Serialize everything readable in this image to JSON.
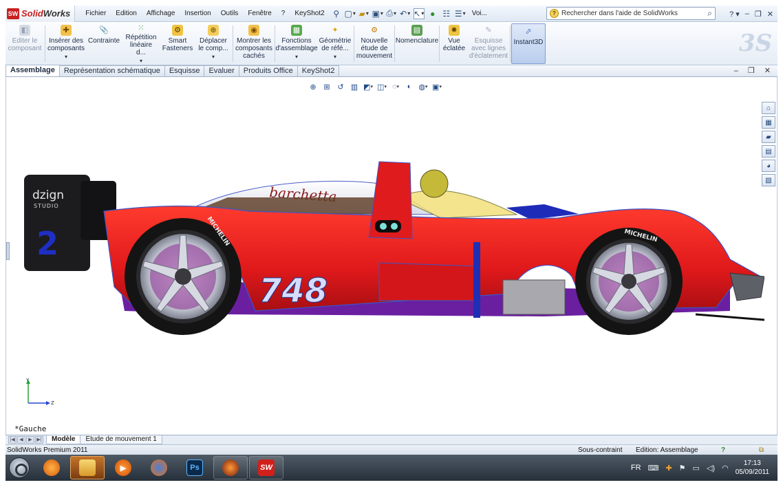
{
  "app": {
    "name_part1": "Solid",
    "name_part2": "Works",
    "badge": "SW"
  },
  "menu": [
    "Fichier",
    "Edition",
    "Affichage",
    "Insertion",
    "Outils",
    "Fenêtre",
    "?",
    "KeyShot2"
  ],
  "toolbar_trailing": "Voi...",
  "help_search": {
    "placeholder": "Rechercher dans l'aide de SolidWorks"
  },
  "ribbon": [
    {
      "id": "edit-component",
      "label": "Editer le composant",
      "icon": "edit-component-icon",
      "disabled": true
    },
    {
      "id": "insert-components",
      "label": "Insérer des composants",
      "icon": "insert-components-icon",
      "dropdown": true
    },
    {
      "id": "mate",
      "label": "Contrainte",
      "icon": "mate-paperclip-icon"
    },
    {
      "id": "linear-pattern",
      "label": "Répétition linéaire d...",
      "icon": "linear-pattern-icon",
      "dropdown": true
    },
    {
      "id": "smart-fasteners",
      "label": "Smart Fasteners",
      "icon": "smart-fasteners-icon"
    },
    {
      "id": "move-component",
      "label": "Déplacer le comp...",
      "icon": "move-component-icon",
      "dropdown": true
    },
    {
      "id": "show-hidden",
      "label": "Montrer les composants cachés",
      "icon": "show-hidden-icon"
    },
    {
      "id": "assembly-features",
      "label": "Fonctions d'assemblage",
      "icon": "assembly-features-icon",
      "dropdown": true
    },
    {
      "id": "reference-geometry",
      "label": "Géométrie de réfé...",
      "icon": "reference-geometry-icon",
      "dropdown": true
    },
    {
      "id": "new-motion-study",
      "label": "Nouvelle étude de mouvement",
      "icon": "motion-study-icon"
    },
    {
      "id": "bom",
      "label": "Nomenclature",
      "icon": "bill-of-materials-icon"
    },
    {
      "id": "exploded-view",
      "label": "Vue éclatée",
      "icon": "exploded-view-icon"
    },
    {
      "id": "explode-line-sketch",
      "label": "Esquisse avec lignes d'éclatement",
      "icon": "explode-line-sketch-icon",
      "disabled": true
    },
    {
      "id": "instant3d",
      "label": "Instant3D",
      "icon": "instant3d-icon",
      "active": true
    }
  ],
  "tabs": [
    "Assemblage",
    "Représentation schématique",
    "Esquisse",
    "Evaluer",
    "Produits Office",
    "KeyShot2"
  ],
  "active_tab": "Assemblage",
  "viewport": {
    "view_name": "*Gauche",
    "triad": {
      "y": "Y",
      "z": "Z"
    },
    "car": {
      "body_color": "#e0191b",
      "number": "748",
      "wing_number": "2",
      "wing_logo_line1": "dzign",
      "wing_logo_line2": "STUDIO",
      "canopy_script": "barchetta",
      "tyre_brand": "MICHELIN"
    }
  },
  "model_tabs": [
    "Modèle",
    "Etude de mouvement 1"
  ],
  "status": {
    "product": "SolidWorks Premium 2011",
    "constraint": "Sous-contraint",
    "edit_mode": "Edition: Assemblage"
  },
  "taskbar": {
    "apps": [
      {
        "name": "firefox-orange",
        "icon": "firefox-icon"
      },
      {
        "name": "folder",
        "icon": "folder-icon",
        "active": true
      },
      {
        "name": "media-player",
        "icon": "media-play-icon"
      },
      {
        "name": "firefox",
        "icon": "firefox-icon"
      },
      {
        "name": "photoshop",
        "icon": "photoshop-icon",
        "text": "Ps"
      },
      {
        "name": "globe",
        "icon": "globe-icon",
        "pinned": true
      },
      {
        "name": "solidworks",
        "icon": "solidworks-icon",
        "text": "SW",
        "pinned": true
      }
    ],
    "language": "FR",
    "time": "17:13",
    "date": "05/09/2011"
  }
}
